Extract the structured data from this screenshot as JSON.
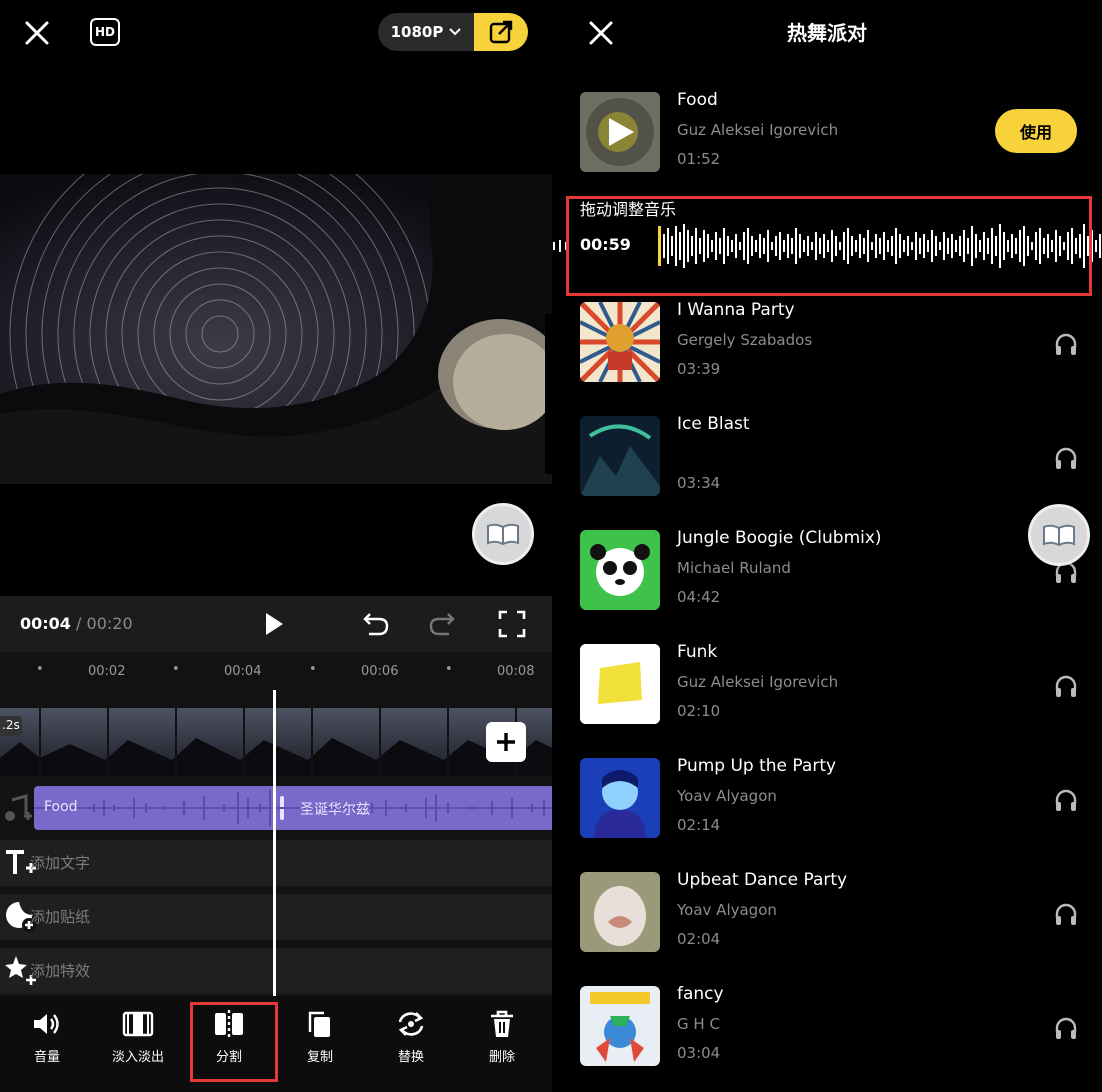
{
  "left": {
    "resolution": "1080P",
    "time": {
      "current": "00:04",
      "separator": "/",
      "total": "00:20"
    },
    "ruler_ticks": [
      "00:02",
      "00:04",
      "00:06",
      "00:08"
    ],
    "clip_duration": ".2s",
    "music_track": {
      "clip1": "Food",
      "clip2": "圣诞华尔兹"
    },
    "tracks": {
      "text": "添加文字",
      "sticker": "添加贴纸",
      "effect": "添加特效"
    },
    "toolbar": [
      {
        "label": "音量",
        "icon": "volume-icon"
      },
      {
        "label": "淡入淡出",
        "icon": "fade-icon"
      },
      {
        "label": "分割",
        "icon": "split-icon"
      },
      {
        "label": "复制",
        "icon": "copy-icon"
      },
      {
        "label": "替换",
        "icon": "replace-icon"
      },
      {
        "label": "删除",
        "icon": "delete-icon"
      }
    ]
  },
  "right": {
    "title": "热舞派对",
    "adjust": {
      "label": "拖动调整音乐",
      "time": "00:59"
    },
    "use_label": "使用",
    "songs": [
      {
        "title": "Food",
        "artist": "Guz Aleksei Igorevich",
        "duration": "01:52"
      },
      {
        "title": "I Wanna Party",
        "artist": "Gergely Szabados",
        "duration": "03:39"
      },
      {
        "title": "Ice Blast",
        "artist": "",
        "duration": "03:34"
      },
      {
        "title": "Jungle Boogie (Clubmix)",
        "artist": "Michael Ruland",
        "duration": "04:42"
      },
      {
        "title": "Funk",
        "artist": "Guz Aleksei Igorevich",
        "duration": "02:10"
      },
      {
        "title": "Pump Up the Party",
        "artist": "Yoav Alyagon",
        "duration": "02:14"
      },
      {
        "title": "Upbeat Dance Party",
        "artist": "Yoav Alyagon",
        "duration": "02:04"
      },
      {
        "title": "fancy",
        "artist": "G H C",
        "duration": "03:04"
      }
    ]
  },
  "colors": {
    "accent_yellow": "#f7d23a",
    "highlight_red": "#e53935",
    "music_purple": "#7b69c9"
  }
}
